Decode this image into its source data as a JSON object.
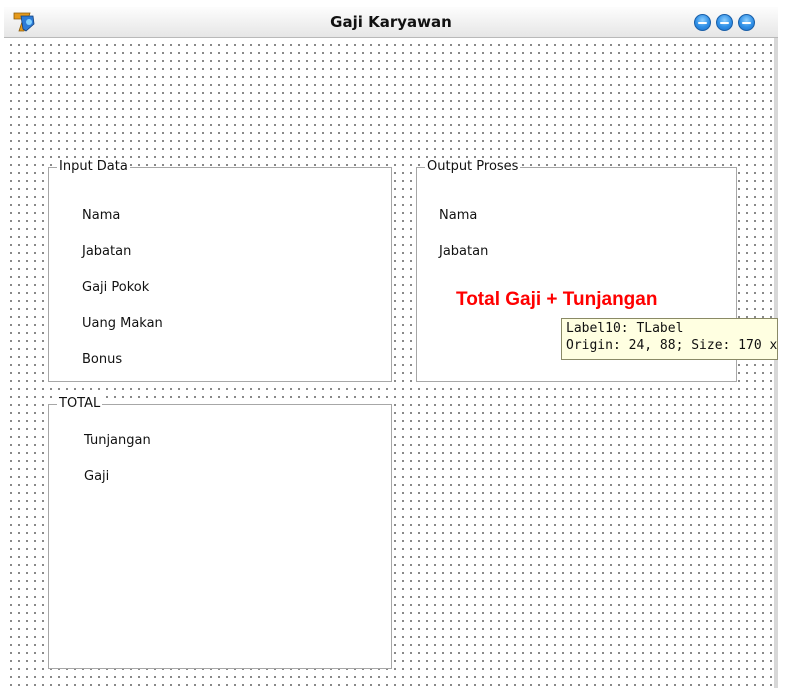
{
  "window": {
    "title": "Gaji Karyawan",
    "buttons": [
      "minimize-button",
      "maximize-button",
      "close-button"
    ]
  },
  "groups": {
    "input": {
      "caption": "Input Data",
      "labels": [
        "Nama",
        "Jabatan",
        "Gaji Pokok",
        "Uang Makan",
        "Bonus"
      ]
    },
    "output": {
      "caption": "Output Proses",
      "labels": [
        "Nama",
        "Jabatan"
      ],
      "highlight": "Total Gaji + Tunjangan"
    },
    "total": {
      "caption": "TOTAL",
      "labels": [
        "Tunjangan",
        "Gaji"
      ]
    }
  },
  "tooltip": {
    "line1": "Label10: TLabel",
    "line2": "Origin: 24, 88; Size: 170 x"
  },
  "colors": {
    "highlight": "#ff0000",
    "tooltip_bg": "#ffffe1",
    "window_button": "#2f8fe6"
  }
}
